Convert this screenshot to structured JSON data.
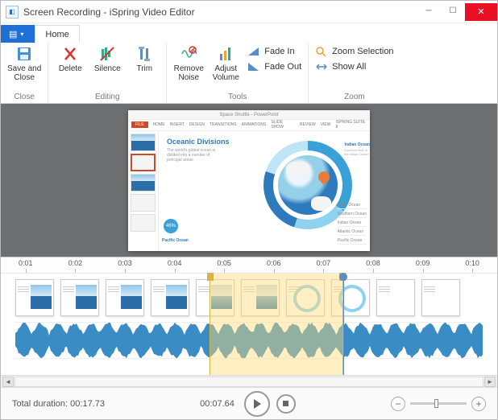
{
  "window": {
    "title": "Screen Recording - iSpring Video Editor"
  },
  "tabs": {
    "home": "Home"
  },
  "ribbon": {
    "close": {
      "label": "Close",
      "save_close": "Save and\nClose"
    },
    "editing": {
      "label": "Editing",
      "delete": "Delete",
      "silence": "Silence",
      "trim": "Trim"
    },
    "tools": {
      "label": "Tools",
      "remove_noise": "Remove\nNoise",
      "adjust_volume": "Adjust\nVolume",
      "fade_in": "Fade In",
      "fade_out": "Fade Out"
    },
    "zoom": {
      "label": "Zoom",
      "zoom_selection": "Zoom Selection",
      "show_all": "Show All"
    }
  },
  "preview": {
    "ppt_title": "Space Shuttle - PowerPoint",
    "ppt_tabs": [
      "FILE",
      "HOME",
      "INSERT",
      "DESIGN",
      "TRANSITIONS",
      "ANIMATIONS",
      "SLIDE SHOW",
      "REVIEW",
      "VIEW",
      "ISPRING SUITE 8"
    ],
    "slide": {
      "title": "Oceanic Divisions",
      "subtitle": "The world's global ocean is divided into a number of principal areas.",
      "pacific_pct": "46%",
      "pacific_label": "Pacific Ocean",
      "indian_label": "Indian Ocean",
      "indian_sub": "Southern limit of the Indian Ocean",
      "legend": [
        "Arctic Ocean",
        "Southern Ocean",
        "Indian Ocean",
        "Atlantic Ocean",
        "Pacific Ocean"
      ]
    }
  },
  "timeline": {
    "marks": [
      "0:01",
      "0:02",
      "0:03",
      "0:04",
      "0:05",
      "0:06",
      "0:07",
      "0:08",
      "0:09",
      "0:10"
    ],
    "selection_start_pct": 42,
    "selection_end_pct": 69,
    "playhead_pct": 69
  },
  "status": {
    "total_label": "Total duration:",
    "total_value": "00:17.73",
    "current_time": "00:07.64"
  }
}
